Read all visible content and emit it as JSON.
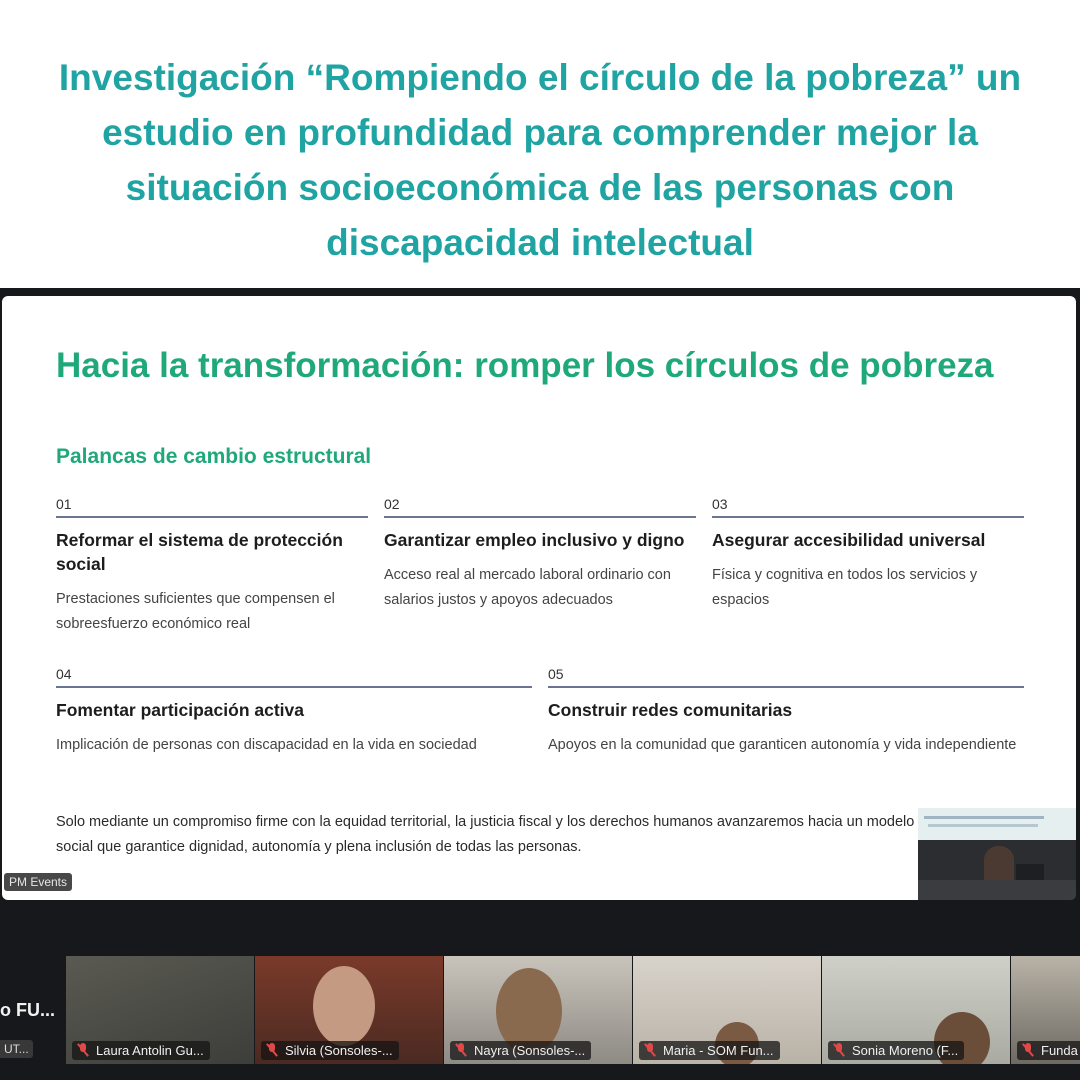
{
  "headline": "Investigación “Rompiendo el círculo de la pobreza” un estudio en profundidad para comprender mejor la situación socioeconómica de las personas con discapacidad intelectual",
  "slide": {
    "title": "Hacia la transformación: romper los círculos de pobreza",
    "subtitle": "Palancas de cambio estructural",
    "levers": [
      {
        "number": "01",
        "title": "Reformar el sistema de protección social",
        "description": "Prestaciones suficientes que compensen el sobreesfuerzo económico real"
      },
      {
        "number": "02",
        "title": "Garantizar empleo inclusivo y digno",
        "description": "Acceso real al mercado laboral ordinario con salarios justos y apoyos adecuados"
      },
      {
        "number": "03",
        "title": "Asegurar accesibilidad universal",
        "description": "Física y cognitiva en todos los servicios y espacios"
      },
      {
        "number": "04",
        "title": "Fomentar participación activa",
        "description": "Implicación de personas con discapacidad en la vida en sociedad"
      },
      {
        "number": "05",
        "title": "Construir redes comunitarias",
        "description": "Apoyos en la comunidad que garanticen autonomía y vida independiente"
      }
    ],
    "closing": "Solo mediante un compromiso firme con la equidad territorial, la justicia fiscal y los derechos humanos avanzaremos hacia un modelo social que garantice dignidad, autonomía y plena inclusión de todas las personas."
  },
  "speaker_label": "PM Events",
  "side_participant": {
    "label": "o  FU...",
    "chip": "UT..."
  },
  "participants": [
    {
      "name": "Laura Antolin Gu...",
      "muted": true
    },
    {
      "name": "Silvia (Sonsoles-...",
      "muted": true
    },
    {
      "name": "Nayra (Sonsoles-...",
      "muted": true
    },
    {
      "name": "Maria - SOM Fun...",
      "muted": true
    },
    {
      "name": "Sonia Moreno (F...",
      "muted": true
    },
    {
      "name": "Funda",
      "muted": true
    }
  ],
  "colors": {
    "headline": "#1fa3a3",
    "slide_accent": "#1fa97a",
    "meeting_bg": "#17181b",
    "muted_icon": "#e24848"
  }
}
